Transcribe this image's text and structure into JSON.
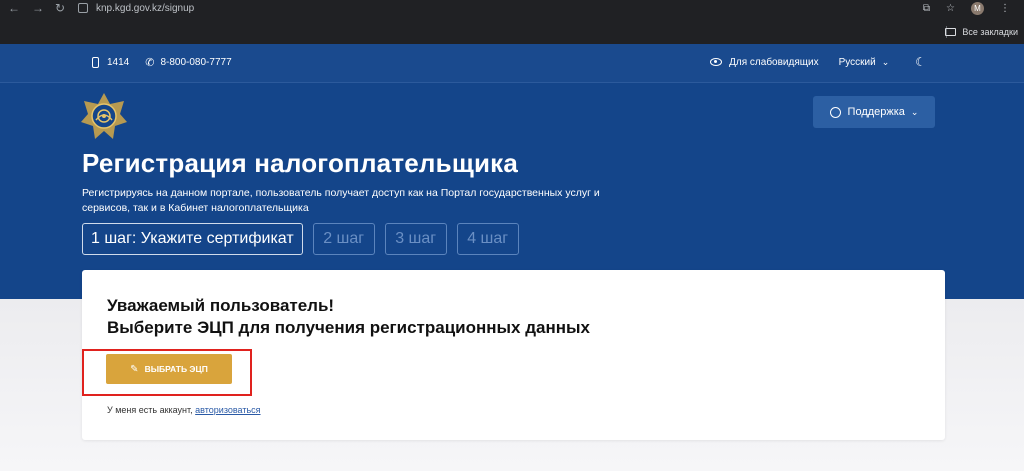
{
  "browser": {
    "url": "knp.kgd.gov.kz/signup",
    "profile_initial": "M",
    "bookmarks_label": "Все закладки"
  },
  "topbar": {
    "short_number": "1414",
    "phone": "8-800-080-7777",
    "accessibility": "Для слабовидящих",
    "language": "Русский"
  },
  "header": {
    "support_label": "Поддержка"
  },
  "registration": {
    "title": "Регистрация налогоплательщика",
    "description": "Регистрируясь на данном портале, пользователь получает доступ как на Портал государственных услуг и сервисов, так и в Кабинет налогоплательщика",
    "steps": [
      {
        "label": "1 шаг: Укажите сертификат",
        "active": true
      },
      {
        "label": "2 шаг",
        "active": false
      },
      {
        "label": "3 шаг",
        "active": false
      },
      {
        "label": "4 шаг",
        "active": false
      }
    ]
  },
  "card": {
    "greeting": "Уважаемый пользователь!",
    "instruction": "Выберите ЭЦП для получения регистрационных данных",
    "ecp_button": "ВЫБРАТЬ ЭЦП",
    "account_text": "У меня есть аккаунт,",
    "login_link": "авторизоваться"
  },
  "colors": {
    "primary_blue": "#14458a",
    "button_gold": "#d9a43c",
    "highlight_red": "#e0221e"
  }
}
